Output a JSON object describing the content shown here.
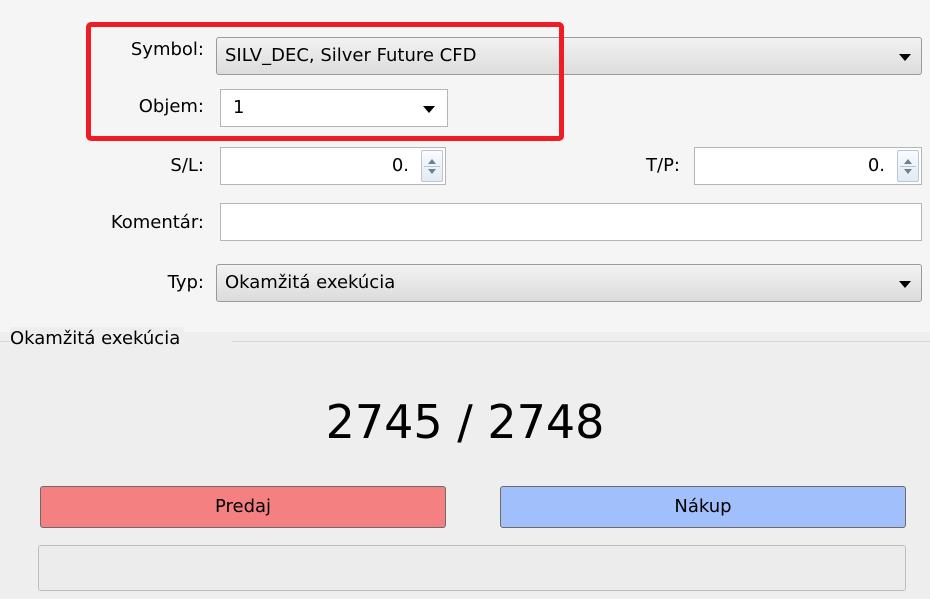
{
  "form": {
    "symbol_label": "Symbol:",
    "symbol_value": "SILV_DEC, Silver Future CFD",
    "volume_label": "Objem:",
    "volume_value": "1",
    "sl_label": "S/L:",
    "sl_value": "0.",
    "tp_label": "T/P:",
    "tp_value": "0.",
    "comment_label": "Komentár:",
    "comment_value": "",
    "type_label": "Typ:",
    "type_value": "Okamžitá exekúcia"
  },
  "execution": {
    "group_title": "Okamžitá exekúcia",
    "price": "2745 / 2748",
    "sell_label": "Predaj",
    "buy_label": "Nákup",
    "status_text": ""
  },
  "colors": {
    "highlight": "#ee1c24",
    "sell": "#f58081",
    "buy": "#a1c0fb"
  },
  "icons": {
    "dropdown": "chevron-down-icon",
    "spinner": "spinner-arrows-icon"
  }
}
